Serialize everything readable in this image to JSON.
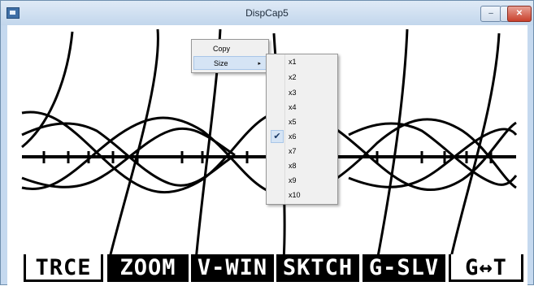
{
  "window": {
    "title": "DispCap5",
    "icons": {
      "app": "picture-icon",
      "minimize": "minimize-icon",
      "maximize": "maximize-icon",
      "close": "close-icon"
    }
  },
  "function_keys": [
    "TRCE",
    "ZOOM",
    "V-WIN",
    "SKTCH",
    "G-SLV",
    "G↔T"
  ],
  "context_menu": {
    "items": [
      {
        "label": "Copy"
      },
      {
        "label": "Size",
        "submenu_arrow": "▸"
      }
    ]
  },
  "size_submenu": {
    "selected": "x6",
    "items": [
      "x1",
      "x2",
      "x3",
      "x4",
      "x5",
      "x6",
      "x7",
      "x8",
      "x9",
      "x10"
    ],
    "check_glyph": "✔"
  }
}
